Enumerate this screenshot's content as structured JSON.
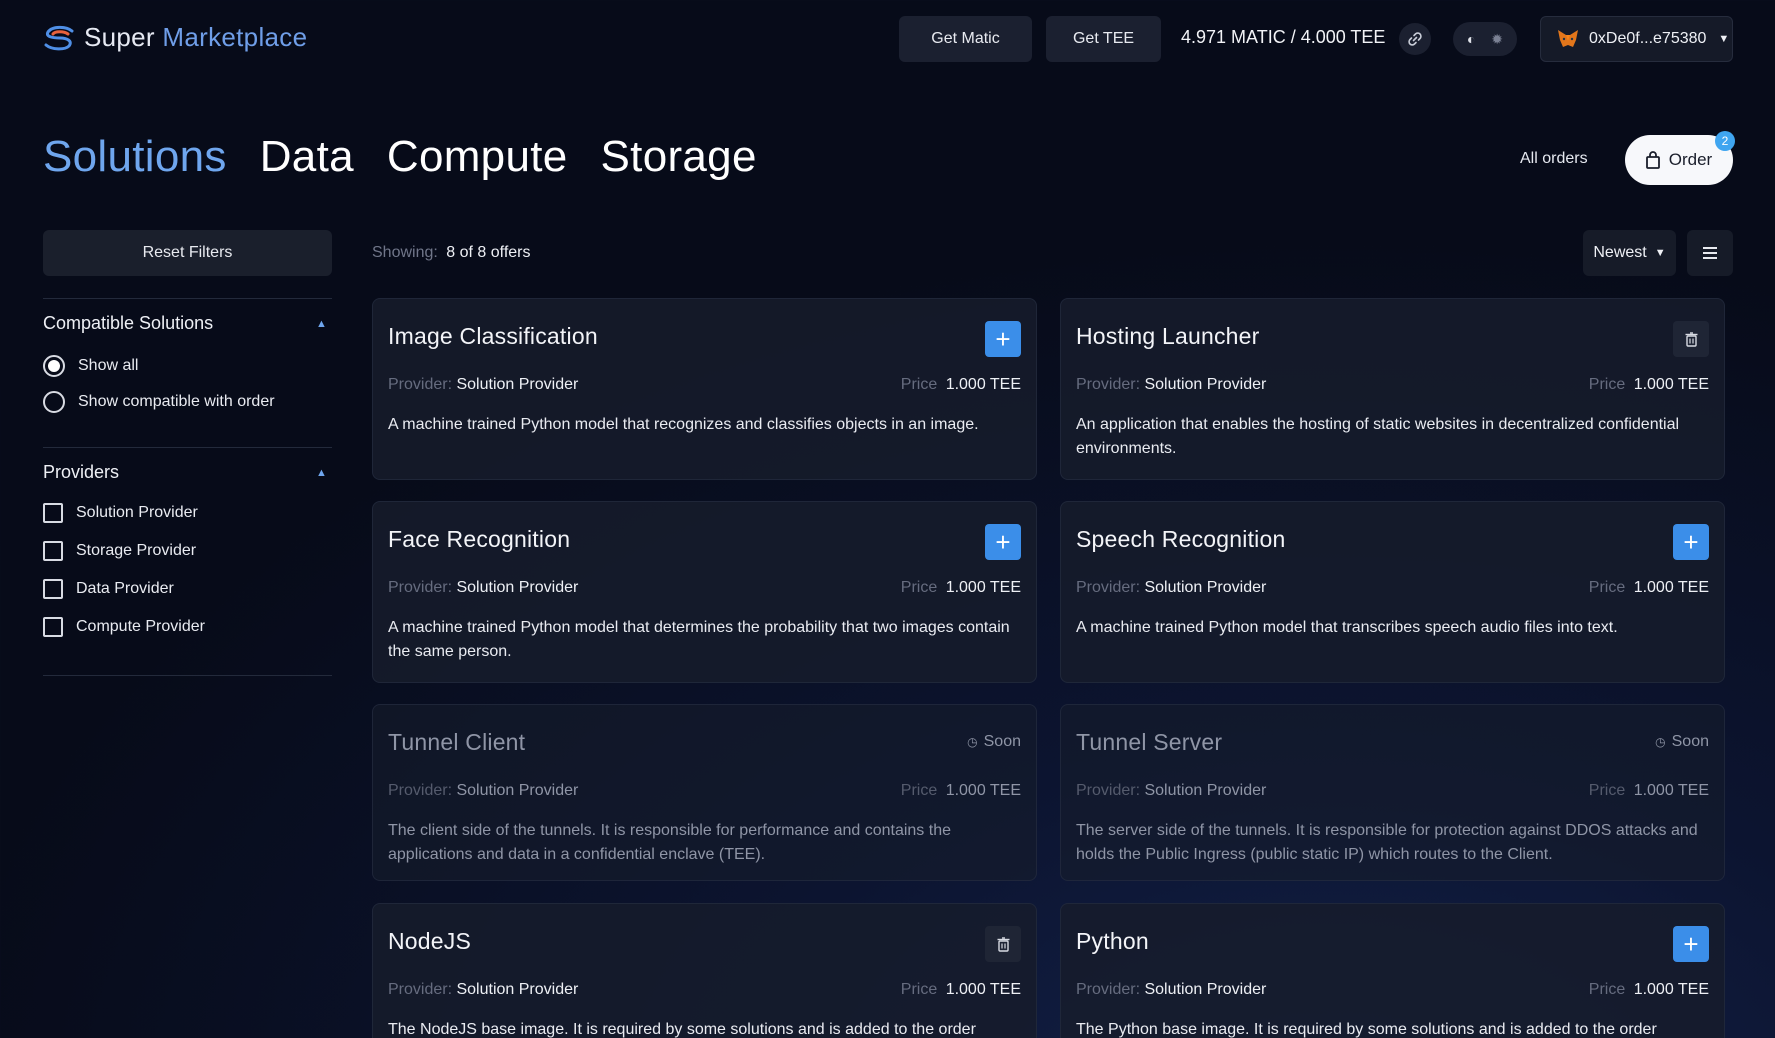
{
  "app": {
    "logo_super": "Super",
    "logo_market": "Marketplace",
    "get_matic": "Get Matic",
    "get_tee": "Get TEE",
    "balance": "4.971 MATIC / 4.000 TEE",
    "wallet": "0xDe0f...e75380"
  },
  "tabs": {
    "solutions": "Solutions",
    "data": "Data",
    "compute": "Compute",
    "storage": "Storage"
  },
  "orders": {
    "all_orders": "All orders",
    "order_label": "Order",
    "order_count": "2"
  },
  "sidebar": {
    "reset": "Reset Filters",
    "compatible": {
      "title": "Compatible Solutions",
      "options": [
        "Show all",
        "Show compatible with order"
      ],
      "selected": "Show all"
    },
    "providers": {
      "title": "Providers",
      "options": [
        "Solution Provider",
        "Storage Provider",
        "Data Provider",
        "Compute Provider"
      ]
    }
  },
  "list": {
    "showing_label": "Showing:",
    "showing_value": "8 of 8 offers",
    "sort": "Newest"
  },
  "labels": {
    "provider": "Provider:",
    "price": "Price",
    "soon": "Soon"
  },
  "cards": [
    {
      "title": "Image Classification",
      "provider": "Solution Provider",
      "price": "1.000 TEE",
      "action": "add",
      "desc": "A machine trained Python model that recognizes and classifies objects in an image."
    },
    {
      "title": "Hosting Launcher",
      "provider": "Solution Provider",
      "price": "1.000 TEE",
      "action": "remove",
      "desc": "An application that enables the hosting of static websites in decentralized confidential environments."
    },
    {
      "title": "Face Recognition",
      "provider": "Solution Provider",
      "price": "1.000 TEE",
      "action": "add",
      "desc": "A machine trained Python model that determines the probability that two images contain the same person."
    },
    {
      "title": "Speech Recognition",
      "provider": "Solution Provider",
      "price": "1.000 TEE",
      "action": "add",
      "desc": "A machine trained Python model that transcribes speech audio files into text."
    },
    {
      "title": "Tunnel Client",
      "provider": "Solution Provider",
      "price": "1.000 TEE",
      "action": "soon",
      "desc": "The client side of the tunnels. It is responsible for performance and contains the applications and data in a confidential enclave (TEE)."
    },
    {
      "title": "Tunnel Server",
      "provider": "Solution Provider",
      "price": "1.000 TEE",
      "action": "soon",
      "desc": "The server side of the tunnels. It is responsible for protection against DDOS attacks and holds the Public Ingress (public static IP) which routes to the Client."
    },
    {
      "title": "NodeJS",
      "provider": "Solution Provider",
      "price": "1.000 TEE",
      "action": "remove",
      "desc": "The NodeJS base image. It is required by some solutions and is added to the order"
    },
    {
      "title": "Python",
      "provider": "Solution Provider",
      "price": "1.000 TEE",
      "action": "add",
      "desc": "The Python base image. It is required by some solutions and is added to the order"
    }
  ]
}
